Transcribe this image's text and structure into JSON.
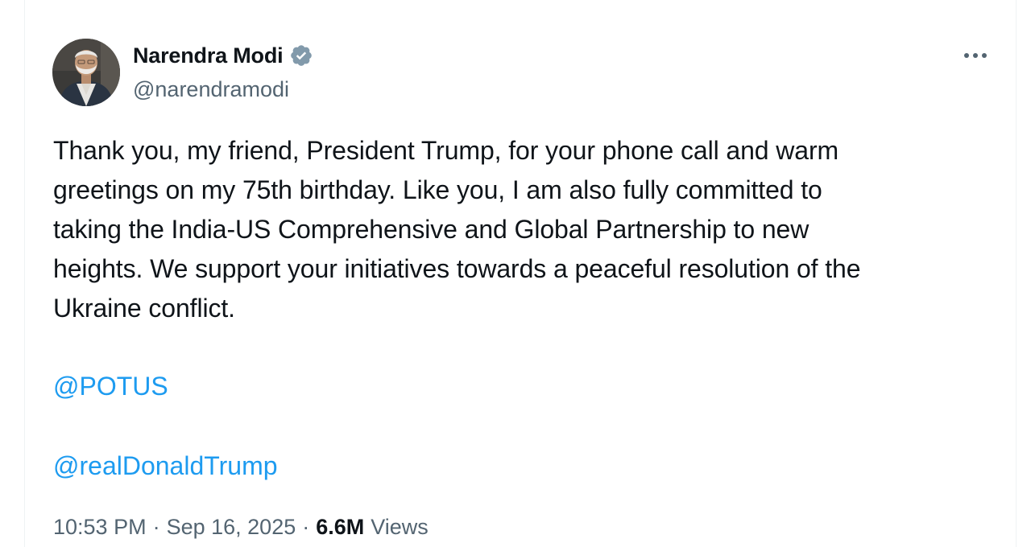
{
  "author": {
    "display_name": "Narendra Modi",
    "handle": "@narendramodi",
    "verified": true,
    "verified_icon": "verified-badge-icon"
  },
  "menu": {
    "icon": "more-options-icon"
  },
  "tweet": {
    "text": "Thank you, my friend, President Trump, for your phone call and warm\ngreetings on my 75th birthday. Like you, I am also fully committed to\ntaking the India-US Comprehensive and Global Partnership to new\nheights. We support your initiatives towards a peaceful resolution of the\nUkraine conflict.",
    "mentions": [
      "@POTUS",
      "@realDonaldTrump"
    ]
  },
  "meta": {
    "time": "10:53 PM",
    "separator": "·",
    "date": "Sep 16, 2025",
    "views_count": "6.6M",
    "views_label": "Views"
  },
  "colors": {
    "text": "#0f1419",
    "secondary": "#536471",
    "link": "#1d9bf0",
    "verified": "#829aab",
    "border": "#eff3f4"
  }
}
